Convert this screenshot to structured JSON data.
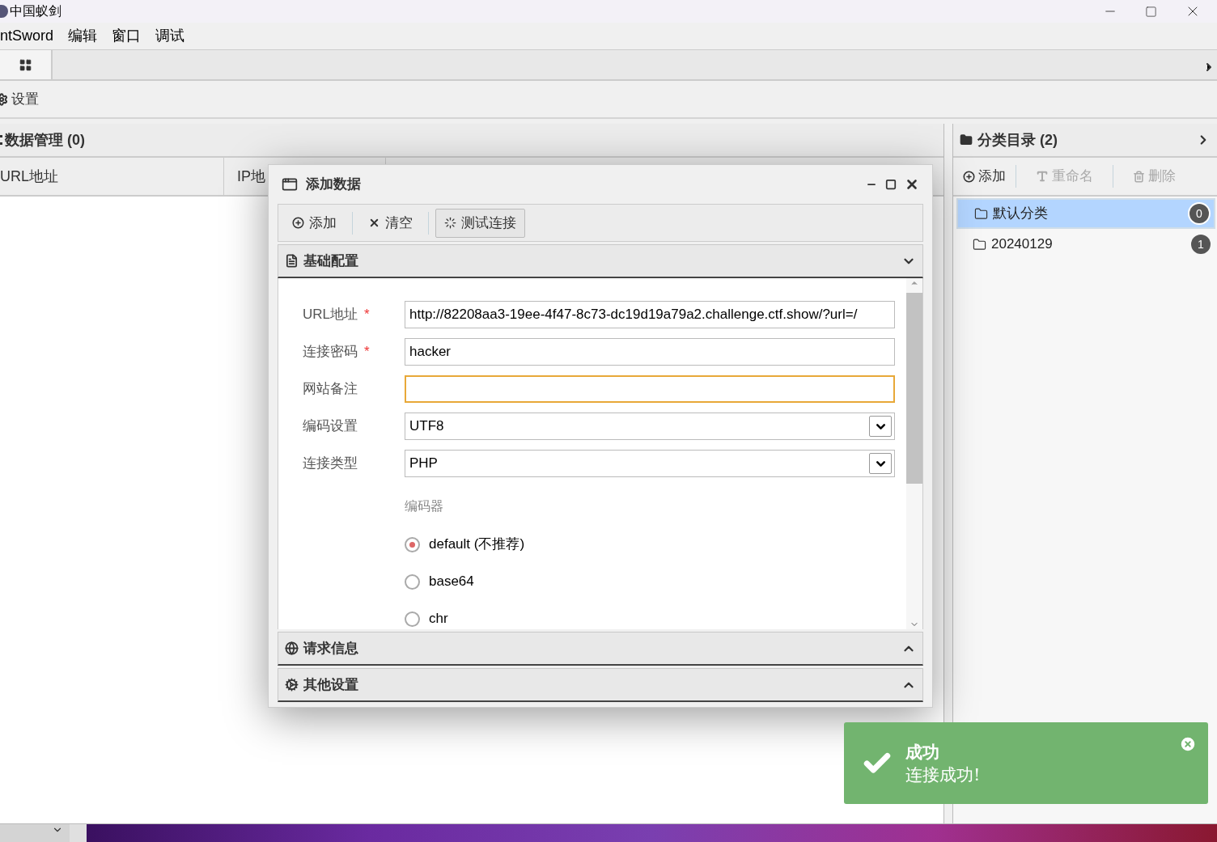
{
  "window": {
    "title": "中国蚁剑"
  },
  "menu": [
    "ntSword",
    "编辑",
    "窗口",
    "调试"
  ],
  "settings_bar": {
    "label": "设置"
  },
  "data_panel": {
    "title": "数据管理 (0)",
    "columns": [
      "URL地址",
      "IP地"
    ]
  },
  "dialog": {
    "title": "添加数据",
    "toolbar": [
      {
        "kind": "add",
        "label": "添加",
        "pressed": false
      },
      {
        "kind": "clear",
        "label": "清空",
        "pressed": false
      },
      {
        "kind": "test",
        "label": "测试连接",
        "pressed": true
      }
    ],
    "sections": [
      {
        "kind": "basic",
        "title": "基础配置",
        "expanded": true
      },
      {
        "kind": "request",
        "title": "请求信息",
        "expanded": false
      },
      {
        "kind": "other",
        "title": "其他设置",
        "expanded": false
      }
    ],
    "fields": [
      {
        "kind": "text",
        "label": "URL地址",
        "required_mark": "*",
        "value": "http://82208aa3-19ee-4f47-8c73-dc19d19a79a2.challenge.ctf.show/?url=/"
      },
      {
        "kind": "text",
        "label": "连接密码",
        "required_mark": "*",
        "value": "hacker"
      },
      {
        "kind": "text",
        "label": "网站备注",
        "focused": true
      },
      {
        "kind": "select",
        "label": "编码设置",
        "value": "UTF8"
      },
      {
        "kind": "select",
        "label": "连接类型",
        "value": "PHP"
      }
    ],
    "encoder": {
      "label": "编码器",
      "options": [
        {
          "label": "default (不推荐)",
          "selected": true
        },
        {
          "label": "base64",
          "selected": false
        },
        {
          "label": "chr",
          "selected": false
        }
      ]
    }
  },
  "category_panel": {
    "title": "分类目录 (2)",
    "actions": [
      {
        "kind": "add",
        "label": "添加",
        "disabled": false
      },
      {
        "kind": "rename",
        "label": "重命名",
        "disabled": true
      },
      {
        "kind": "delete",
        "label": "删除",
        "disabled": true
      }
    ],
    "items": [
      {
        "label": "默认分类",
        "count": "0",
        "selected": true
      },
      {
        "label": "20240129",
        "count": "1",
        "selected": false
      }
    ]
  },
  "toast": {
    "title": "成功",
    "message": "连接成功!"
  }
}
